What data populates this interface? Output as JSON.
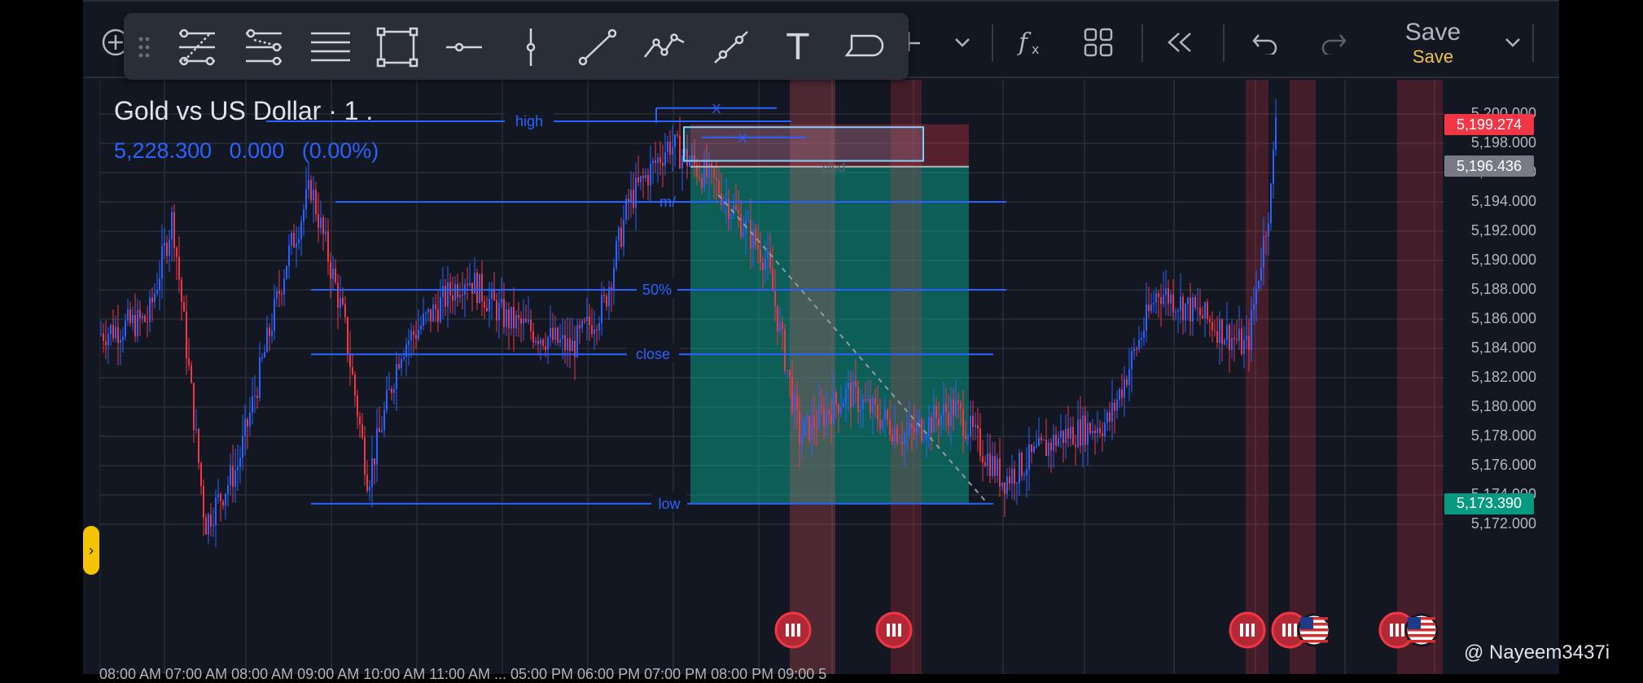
{
  "toolbar": {
    "save_label": "Save",
    "save_sublabel": "Save",
    "icons": [
      "add-icon",
      "cursor-icon",
      "chevron-down-icon",
      "fx-icon",
      "layout-grid-icon",
      "replay-icon",
      "undo-icon",
      "redo-icon",
      "save-dropdown-icon"
    ]
  },
  "drawing_toolbar": {
    "tools": [
      "drag-handle-icon",
      "pitchfork-icon",
      "fib-channel-icon",
      "parallel-lines-icon",
      "rectangle-icon",
      "horizontal-line-icon",
      "vertical-line-icon",
      "trend-line-icon",
      "path-icon",
      "segment-icon",
      "text-icon",
      "callout-icon"
    ],
    "text_tool_glyph": "T"
  },
  "symbol": {
    "name": "Gold vs US Dollar · 1 .",
    "price": "5,228.300",
    "change": "0.000",
    "change_pct": "(0.00%)"
  },
  "price_axis": {
    "ticks": [
      "5,200.000",
      "5,198.000",
      "5,196.000",
      "5,194.000",
      "5,192.000",
      "5,190.000",
      "5,188.000",
      "5,186.000",
      "5,184.000",
      "5,182.000",
      "5,180.000",
      "5,178.000",
      "5,176.000",
      "5,174.000",
      "5,172.000"
    ],
    "tag_red": "5,199.274",
    "tag_grey": "5,196.436",
    "tag_green": "5,173.390",
    "color_red_tag": "#f23645",
    "color_grey_tag": "#787b86",
    "color_green_tag": "#089981"
  },
  "drawings": {
    "label_high": "high",
    "label_50": "50%",
    "label_close": "close",
    "label_low": "low",
    "label_clsd": "clsd",
    "label_x": "X",
    "label_x2": "X",
    "label_top_partial": "m/",
    "line_color": "#2962ff",
    "profit_zone_color": "#089981",
    "loss_zone_color": "#f23645"
  },
  "time_axis": "08:00 AM    07:00 AM    08:00 AM    09:00 AM    10:00 AM    11:00 AM   ...   05:00 PM    06:00 PM    07:00 PM    08:00 PM    09:00 5",
  "side_toggle": "›",
  "watermark": "@ Nayeem3437i",
  "colors": {
    "bg": "#131722",
    "up": "#2962ff",
    "down": "#f23645"
  }
}
